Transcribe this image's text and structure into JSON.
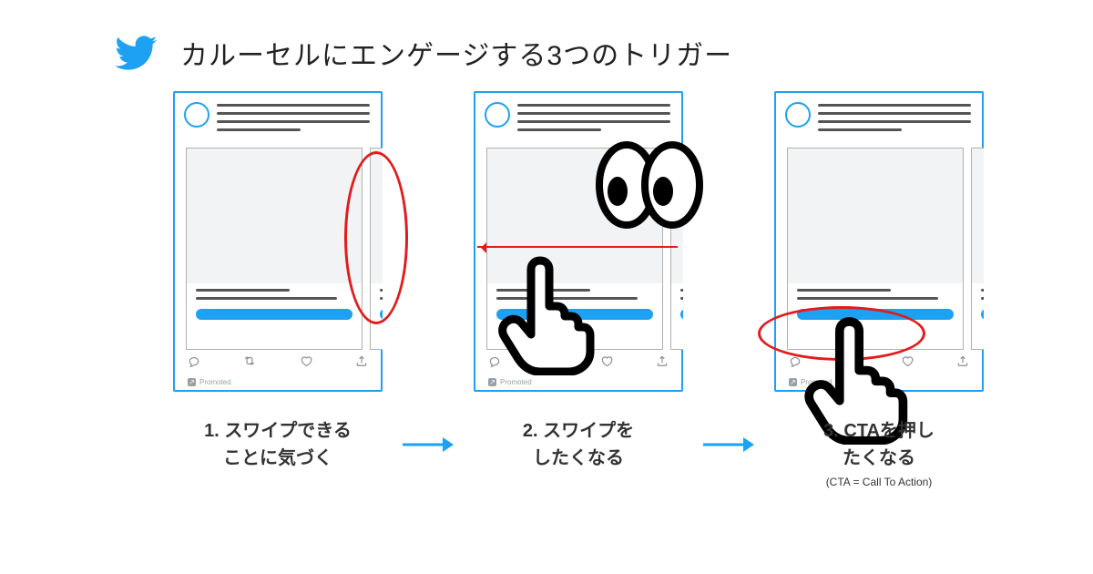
{
  "colors": {
    "accent": "#1DA1F2",
    "annotation": "#e21b1b",
    "ink": "#333333"
  },
  "title": "カルーセルにエンゲージする3つのトリガー",
  "promoted_label": "Promoted",
  "captions": [
    {
      "num": "1.",
      "line1": "スワイプできる",
      "line2": "ことに気づく"
    },
    {
      "num": "2.",
      "line1": "スワイプを",
      "line2": "したくなる"
    },
    {
      "num": "3.",
      "line1": "CTAを押し",
      "line2": "たくなる",
      "sub": "(CTA = Call To Action)"
    }
  ]
}
